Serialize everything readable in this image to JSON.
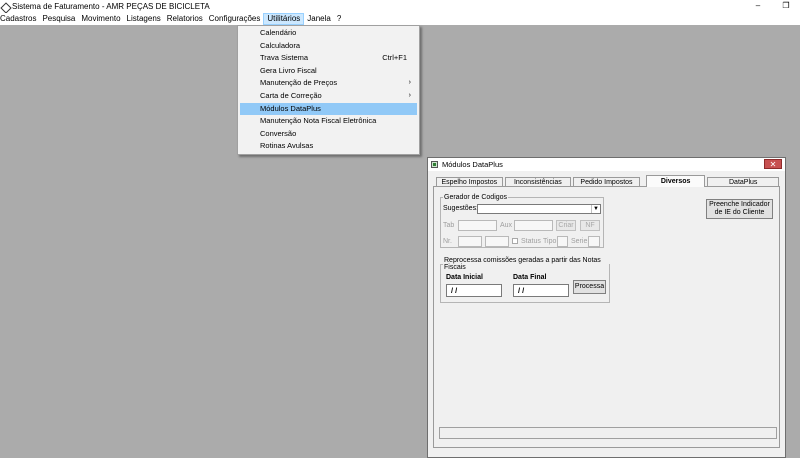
{
  "window": {
    "title": "Sistema de Faturamento - AMR PEÇAS DE BICICLETA",
    "minimize": "–",
    "restore": "❐"
  },
  "menubar": {
    "items": [
      "Cadastros",
      "Pesquisa",
      "Movimento",
      "Listagens",
      "Relatorios",
      "Configurações",
      "Utilitários",
      "Janela",
      "?"
    ]
  },
  "utilitarios_menu": {
    "items": [
      {
        "label": "Calendário"
      },
      {
        "label": "Calculadora"
      },
      {
        "label": "Trava Sistema",
        "shortcut": "Ctrl+F1"
      },
      {
        "label": "Gera Livro Fiscal"
      },
      {
        "label": "Manutenção de Preços",
        "submenu": "›"
      },
      {
        "label": "Carta de Correção",
        "submenu": "›"
      },
      {
        "label": "Módulos DataPlus"
      },
      {
        "label": "Manutenção Nota Fiscal Eletrônica"
      },
      {
        "label": "Conversão"
      },
      {
        "label": "Rotinas Avulsas"
      }
    ]
  },
  "child_window": {
    "title": "Módulos DataPlus",
    "close": "✕",
    "tabs": [
      "Espelho Impostos",
      "Inconsistências",
      "Pedido Impostos",
      "Diversos",
      "DataPlus"
    ],
    "gerador": {
      "legend": "Gerador de Codigos",
      "sugestoes_label": "Sugestões:",
      "sugestoes_value": "",
      "combo_arrow": "▼",
      "tab_label": "Tab",
      "aux_label": "Aux",
      "criar_button": "Criar",
      "nf_button": "NF",
      "nr_label": "Nr.",
      "status_label": "Status",
      "tipo_label": "Tipo",
      "serie_label": "Serie"
    },
    "preenche_button": "Preenche Indicador de IE do Cliente",
    "reprocessa": {
      "legend": "Reprocessa comissões geradas a partir das Notas Fiscais",
      "data_inicial_label": "Data Inicial",
      "data_inicial_value": " / /",
      "data_final_label": "Data Final",
      "data_final_value": " / /",
      "processa_button": "Processa"
    }
  }
}
